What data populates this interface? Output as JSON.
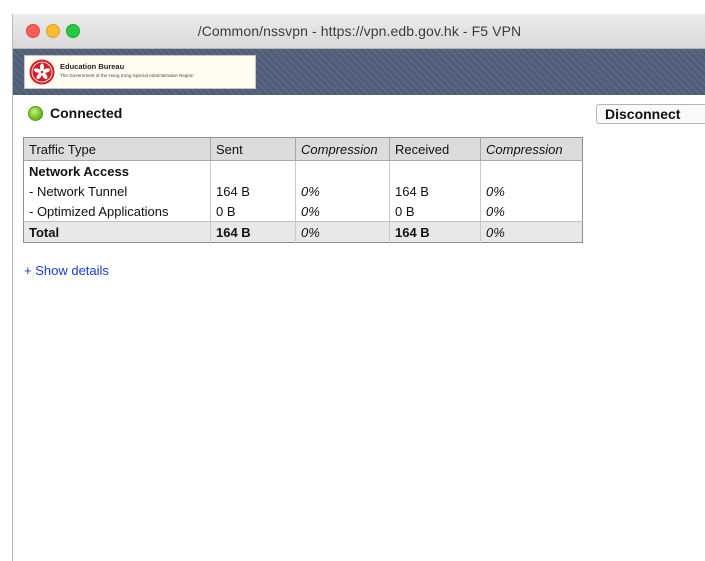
{
  "window": {
    "title": "/Common/nssvpn - https://vpn.edb.gov.hk - F5 VPN"
  },
  "banner": {
    "org_name": "Education Bureau",
    "org_sub": "The Government of the Hong Kong Special Administrative Region",
    "emblem_icon": "hksar-bauhinia-emblem-icon"
  },
  "status": {
    "label": "Connected",
    "indicator_color": "#7fcc2e"
  },
  "actions": {
    "disconnect_label": "Disconnect"
  },
  "table": {
    "headers": [
      "Traffic Type",
      "Sent",
      "Compression",
      "Received",
      "Compression"
    ],
    "category": "Network Access",
    "rows": [
      {
        "type": "- Network Tunnel",
        "sent": "164 B",
        "sent_comp": "0%",
        "received": "164 B",
        "recv_comp": "0%"
      },
      {
        "type": "- Optimized Applications",
        "sent": "0 B",
        "sent_comp": "0%",
        "received": "0 B",
        "recv_comp": "0%"
      }
    ],
    "total": {
      "type": "Total",
      "sent": "164 B",
      "sent_comp": "0%",
      "received": "164 B",
      "recv_comp": "0%"
    }
  },
  "links": {
    "show_details": "+ Show details"
  }
}
